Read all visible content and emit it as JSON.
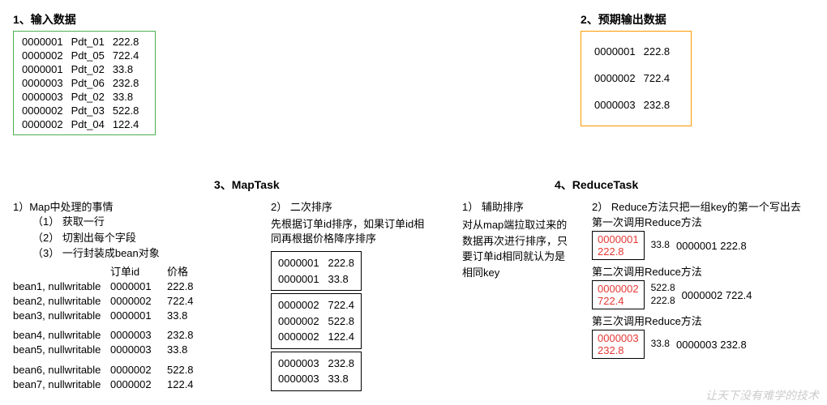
{
  "section1": {
    "title": "1、输入数据",
    "rows": [
      [
        "0000001",
        "Pdt_01",
        "222.8"
      ],
      [
        "0000002",
        "Pdt_05",
        "722.4"
      ],
      [
        "0000001",
        "Pdt_02",
        "33.8"
      ],
      [
        "0000003",
        "Pdt_06",
        "232.8"
      ],
      [
        "0000003",
        "Pdt_02",
        "33.8"
      ],
      [
        "0000002",
        "Pdt_03",
        "522.8"
      ],
      [
        "0000002",
        "Pdt_04",
        "122.4"
      ]
    ]
  },
  "section2": {
    "title": "2、预期输出数据",
    "rows": [
      [
        "0000001",
        "222.8"
      ],
      [
        "0000002",
        "722.4"
      ],
      [
        "0000003",
        "232.8"
      ]
    ]
  },
  "section3": {
    "title": "3、MapTask",
    "sub1": {
      "title": "1）Map中处理的事情",
      "steps": [
        "（1） 获取一行",
        "（2） 切割出每个字段",
        "（3） 一行封装成bean对象"
      ],
      "headers": [
        "订单id",
        "价格"
      ],
      "beans": [
        [
          "bean1, nullwritable",
          "0000001",
          "222.8"
        ],
        [
          "bean2, nullwritable",
          "0000002",
          "722.4"
        ],
        [
          "bean3, nullwritable",
          "0000001",
          "33.8"
        ],
        [
          "bean4, nullwritable",
          "0000003",
          "232.8"
        ],
        [
          "bean5, nullwritable",
          "0000003",
          "33.8"
        ],
        [
          "bean6, nullwritable",
          "0000002",
          "522.8"
        ],
        [
          "bean7, nullwritable",
          "0000002",
          "122.4"
        ]
      ]
    },
    "sub2": {
      "title": "2） 二次排序",
      "desc": "先根据订单id排序，如果订单id相同再根据价格降序排序",
      "groups": [
        [
          [
            "0000001",
            "222.8"
          ],
          [
            "0000001",
            "33.8"
          ]
        ],
        [
          [
            "0000002",
            "722.4"
          ],
          [
            "0000002",
            "522.8"
          ],
          [
            "0000002",
            "122.4"
          ]
        ],
        [
          [
            "0000003",
            "232.8"
          ],
          [
            "0000003",
            "33.8"
          ]
        ]
      ]
    }
  },
  "section4": {
    "title": "4、ReduceTask",
    "sub1": {
      "title": "1） 辅助排序",
      "desc": "对从map端拉取过来的数据再次进行排序，只要订单id相同就认为是相同key"
    },
    "sub2": {
      "title": "2） Reduce方法只把一组key的第一个写出去",
      "calls": [
        {
          "label": "第一次调用Reduce方法",
          "key_id": "0000001",
          "key_val": "222.8",
          "extra": [
            "33.8"
          ],
          "out_id": "0000001",
          "out_val": "222.8"
        },
        {
          "label": "第二次调用Reduce方法",
          "key_id": "0000002",
          "key_val": "722.4",
          "extra": [
            "522.8",
            "222.8"
          ],
          "out_id": "0000002",
          "out_val": "722.4"
        },
        {
          "label": "第三次调用Reduce方法",
          "key_id": "0000003",
          "key_val": "232.8",
          "extra": [
            "33.8"
          ],
          "out_id": "0000003",
          "out_val": "232.8"
        }
      ]
    }
  },
  "watermark": "让天下没有难学的技术"
}
